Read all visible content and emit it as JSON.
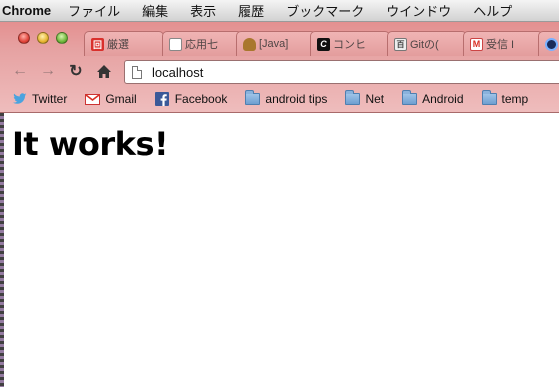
{
  "menubar": {
    "app_name": "Chrome",
    "items": [
      "ファイル",
      "編集",
      "表示",
      "履歴",
      "ブックマーク",
      "ウインドウ",
      "ヘルプ"
    ]
  },
  "tabs": [
    {
      "label": "厳選",
      "icon": "red-logo-icon"
    },
    {
      "label": "応用七",
      "icon": "page-icon"
    },
    {
      "label": "[Java]",
      "icon": "poop-icon"
    },
    {
      "label": "コンヒ",
      "icon": "c-logo-icon"
    },
    {
      "label": "Gitの(",
      "icon": "hyaku-icon"
    },
    {
      "label": "受信 I",
      "icon": "gmail-icon"
    },
    {
      "label": "",
      "icon": "swirl-icon"
    }
  ],
  "toolbar": {
    "url": "localhost"
  },
  "bookmarks": [
    {
      "label": "Twitter",
      "icon": "twitter-icon"
    },
    {
      "label": "Gmail",
      "icon": "gmail-icon"
    },
    {
      "label": "Facebook",
      "icon": "facebook-icon"
    },
    {
      "label": "android tips",
      "icon": "folder-icon"
    },
    {
      "label": "Net",
      "icon": "folder-icon"
    },
    {
      "label": "Android",
      "icon": "folder-icon"
    },
    {
      "label": "temp",
      "icon": "folder-icon"
    }
  ],
  "page": {
    "heading": "It works!"
  }
}
